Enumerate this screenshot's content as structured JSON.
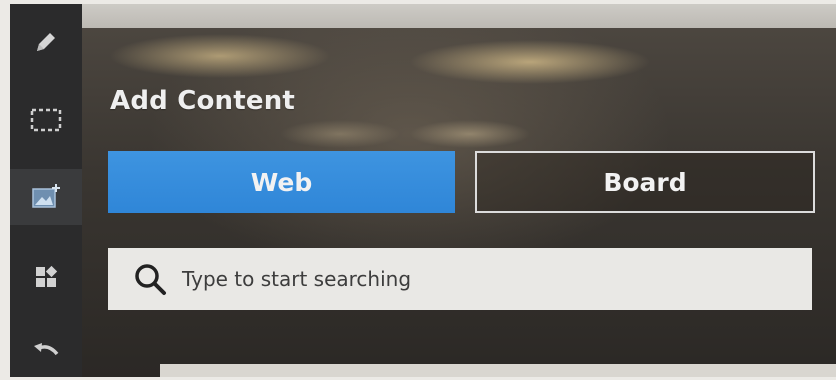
{
  "sidebar": {
    "tools": [
      {
        "name": "pen",
        "icon": "pencil-icon"
      },
      {
        "name": "select",
        "icon": "dashed-selection-icon"
      },
      {
        "name": "add-image",
        "icon": "image-add-icon"
      },
      {
        "name": "apps",
        "icon": "widgets-icon"
      },
      {
        "name": "undo",
        "icon": "undo-icon"
      }
    ],
    "active_tool": "add-image"
  },
  "panel": {
    "title": "Add Content",
    "tabs": [
      {
        "label": "Web",
        "selected": true
      },
      {
        "label": "Board",
        "selected": false
      }
    ],
    "search": {
      "placeholder": "Type to start searching",
      "icon": "search-icon"
    }
  },
  "colors": {
    "accent": "#2f86d8",
    "sidebar_bg": "#2b2b2c",
    "text_light": "#efefef"
  }
}
